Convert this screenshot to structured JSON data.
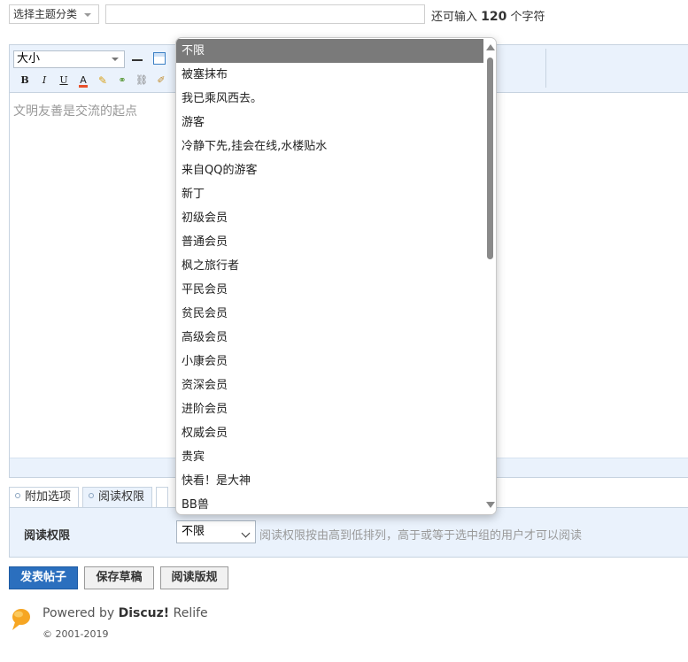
{
  "topbar": {
    "category_select": "选择主题分类",
    "subject_value": "",
    "remain_prefix": "还可输入",
    "remain_count": "120",
    "remain_suffix": "个字符"
  },
  "editor": {
    "font_size_select": "大小",
    "buttons": {
      "bold": "B",
      "italic": "I",
      "underline": "U",
      "font_color": "A",
      "spellcheck": "abc"
    },
    "placeholder": "文明友善是交流的起点"
  },
  "tabs": [
    {
      "label": "附加选项"
    },
    {
      "label": "阅读权限"
    }
  ],
  "read_permission": {
    "label": "阅读权限",
    "selected": "不限",
    "note": "阅读权限按由高到低排列，高于或等于选中组的用户才可以阅读"
  },
  "actions": {
    "post": "发表帖子",
    "save_draft": "保存草稿",
    "read_rules": "阅读版规"
  },
  "footer": {
    "powered_prefix": "Powered by",
    "brand": "Discuz!",
    "theme": "Relife",
    "copyright": "© 2001-2019"
  },
  "dropdown": {
    "selected_index": 0,
    "options": [
      "不限",
      "被塞抹布",
      "我已乘风西去。",
      "游客",
      "冷静下先,挂会在线,水楼贴水",
      "来自QQ的游客",
      "新丁",
      "初级会员",
      "普通会员",
      "枫之旅行者",
      "平民会员",
      "贫民会员",
      "高级会员",
      "小康会员",
      "资深会员",
      "进阶会员",
      "权威会员",
      "贵宾",
      "快看！是大神",
      "BB兽"
    ]
  },
  "colors": {
    "accent": "#2b6fbe",
    "panel_bg": "#eaf2fc",
    "selected_option_bg": "#7a7a7a"
  }
}
